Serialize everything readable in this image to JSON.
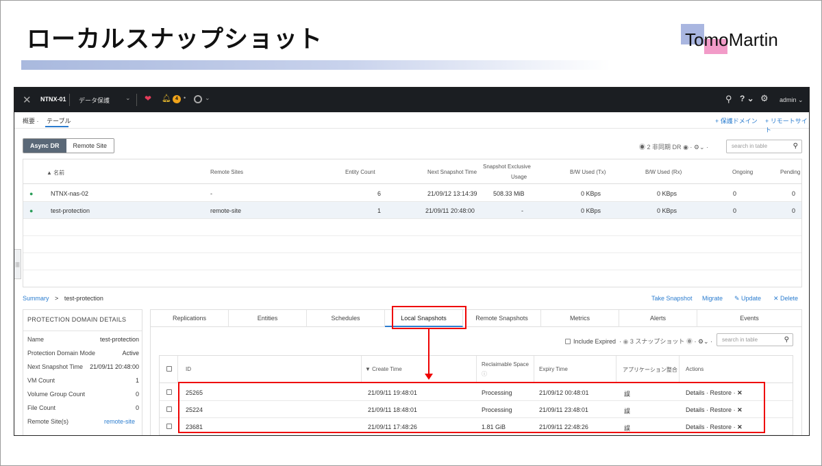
{
  "slide": {
    "title": "ローカルスナップショット",
    "logo_text": "TomoMartin"
  },
  "topnav": {
    "cluster": "NTNX-01",
    "menu": "データ保護",
    "alert_count": "4",
    "user": "admin"
  },
  "breadcrumb": {
    "summary": "概要",
    "table": "テーブル",
    "sep": "·",
    "add_domain": "+ 保護ドメイン",
    "add_remote": "+ リモートサイト"
  },
  "toggle": {
    "async": "Async DR",
    "remote": "Remote Site"
  },
  "pd_controls": {
    "count": "2 非同期 DR",
    "search_placeholder": "search in table"
  },
  "pd_table": {
    "headers": [
      "▲ 名前",
      "Remote Sites",
      "Entity Count",
      "Next Snapshot Time",
      "Snapshot Exclusive",
      "Usage",
      "B/W Used (Tx)",
      "B/W Used (Rx)",
      "Ongoing",
      "Pending"
    ],
    "rows": [
      {
        "name": "NTNX-nas-02",
        "remote": "-",
        "entities": "6",
        "next": "21/09/12 13:14:39",
        "usage": "508.33 MiB",
        "tx": "0 KBps",
        "rx": "0 KBps",
        "ongoing": "0",
        "pending": "0"
      },
      {
        "name": "test-protection",
        "remote": "remote-site",
        "entities": "1",
        "next": "21/09/11 20:48:00",
        "usage": "-",
        "tx": "0 KBps",
        "rx": "0 KBps",
        "ongoing": "0",
        "pending": "0"
      }
    ]
  },
  "summary_bar": {
    "summary": "Summary",
    "arrow": ">",
    "current": "test-protection",
    "take": "Take Snapshot",
    "migrate": "Migrate",
    "update": "✎ Update",
    "delete": "✕ Delete"
  },
  "details": {
    "title": "PROTECTION DOMAIN DETAILS",
    "rows": [
      {
        "label": "Name",
        "value": "test-protection"
      },
      {
        "label": "Protection Domain Mode",
        "value": "Active"
      },
      {
        "label": "Next Snapshot Time",
        "value": "21/09/11 20:48:00"
      },
      {
        "label": "VM Count",
        "value": "1"
      },
      {
        "label": "Volume Group Count",
        "value": "0"
      },
      {
        "label": "File Count",
        "value": "0"
      },
      {
        "label": "Remote Site(s)",
        "value": "remote-site"
      }
    ]
  },
  "tabs": [
    "Replications",
    "Entities",
    "Schedules",
    "Local Snapshots",
    "Remote Snapshots",
    "Metrics",
    "Alerts",
    "Events"
  ],
  "snap_controls": {
    "include_expired": "Include Expired",
    "count": "3 スナップショット",
    "search_placeholder": "search in table"
  },
  "snap_table": {
    "headers": {
      "id": "ID",
      "create": "▼ Create Time",
      "reclaim1": "Reclaimable Space",
      "expiry": "Expiry Time",
      "app": "アプリケーション整合",
      "actions": "Actions"
    },
    "rows": [
      {
        "id": "25265",
        "create": "21/09/11 19:48:01",
        "reclaim": "Processing",
        "expiry": "21/09/12 00:48:01",
        "app": "誤"
      },
      {
        "id": "25224",
        "create": "21/09/11 18:48:01",
        "reclaim": "Processing",
        "expiry": "21/09/11 23:48:01",
        "app": "誤"
      },
      {
        "id": "23681",
        "create": "21/09/11 17:48:26",
        "reclaim": "1.81 GiB",
        "expiry": "21/09/11 22:48:26",
        "app": "誤"
      }
    ],
    "action_details": "Details",
    "action_restore": "Restore",
    "action_sep": "·",
    "action_delete": "✕"
  }
}
